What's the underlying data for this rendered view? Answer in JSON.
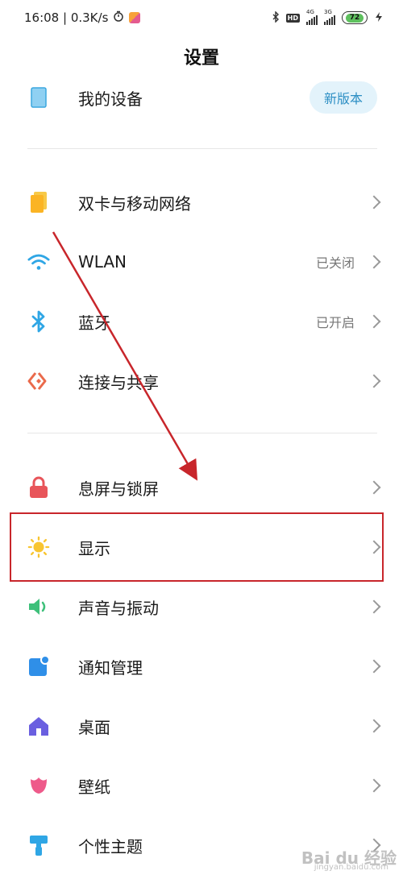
{
  "status_bar": {
    "time_speed": "16:08 | 0.3K/s",
    "net1_gen": "4G",
    "net2_gen": "3G",
    "hd_label": "HD",
    "battery": "72"
  },
  "header": {
    "title": "设置"
  },
  "device": {
    "label": "我的设备",
    "badge": "新版本"
  },
  "rows": [
    {
      "label": "双卡与移动网络",
      "value": ""
    },
    {
      "label": "WLAN",
      "value": "已关闭"
    },
    {
      "label": "蓝牙",
      "value": "已开启"
    },
    {
      "label": "连接与共享",
      "value": ""
    },
    {
      "label": "息屏与锁屏",
      "value": ""
    },
    {
      "label": "显示",
      "value": ""
    },
    {
      "label": "声音与振动",
      "value": ""
    },
    {
      "label": "通知管理",
      "value": ""
    },
    {
      "label": "桌面",
      "value": ""
    },
    {
      "label": "壁纸",
      "value": ""
    },
    {
      "label": "个性主题",
      "value": ""
    }
  ],
  "watermark": {
    "text": "Bai du 经验",
    "sub": "jingyan.baidu.com"
  },
  "colors": {
    "accent_blue": "#2d8fc4",
    "highlight_red": "#c8262b",
    "battery_green": "#5ec05e"
  }
}
